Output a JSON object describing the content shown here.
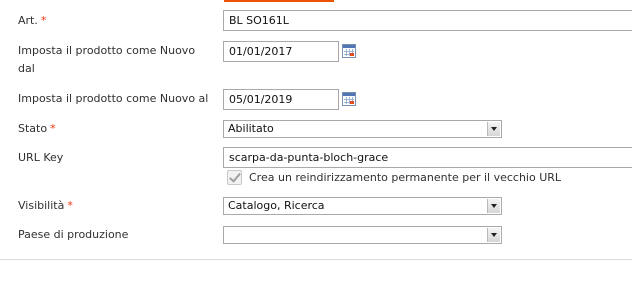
{
  "form": {
    "sku": {
      "label": "Art.",
      "required": "*",
      "value": "BL SO161L"
    },
    "new_from": {
      "label_line1": "Imposta il prodotto come Nuovo",
      "label_line2": "dal",
      "value": "01/01/2017",
      "icon": "calendar-icon"
    },
    "new_to": {
      "label": "Imposta il prodotto come Nuovo al",
      "value": "05/01/2019",
      "icon": "calendar-icon"
    },
    "status": {
      "label": "Stato",
      "required": "*",
      "value": "Abilitato"
    },
    "url_key": {
      "label": "URL Key",
      "value": "scarpa-da-punta-bloch-grace",
      "redirect_label": "Crea un reindirizzamento permanente per il vecchio URL",
      "redirect_checked": true
    },
    "visibility": {
      "label": "Visibilità",
      "required": "*",
      "value": "Catalogo, Ricerca"
    },
    "country": {
      "label": "Paese di produzione",
      "value": ""
    }
  },
  "colors": {
    "accent": "#eb5202",
    "required": "#eb340a",
    "border": "#a9a9a9"
  }
}
